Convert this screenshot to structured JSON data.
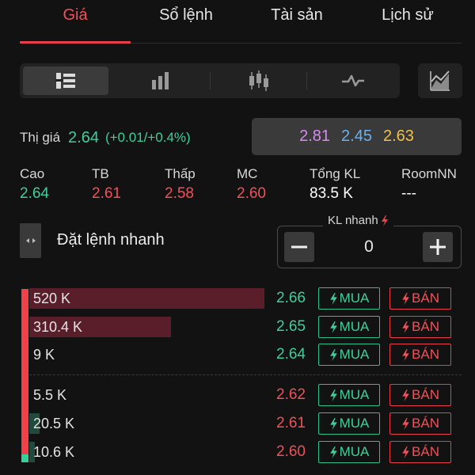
{
  "tabs": [
    {
      "label": "Giá",
      "active": true
    },
    {
      "label": "Sổ lệnh",
      "active": false
    },
    {
      "label": "Tài sản",
      "active": false
    },
    {
      "label": "Lịch sử",
      "active": false
    }
  ],
  "toolbar": {
    "icons": [
      "order-book-icon",
      "bar-chart-icon",
      "candlestick-icon",
      "line-chart-icon"
    ],
    "active_index": 0,
    "side_icon": "chart-expand-icon"
  },
  "price": {
    "label": "Thị giá",
    "value": "2.64",
    "change": "(+0.01/+0.4%)"
  },
  "reference": {
    "ceiling": "2.81",
    "floor": "2.45",
    "ref": "2.63"
  },
  "stats": [
    {
      "label": "Cao",
      "value": "2.64",
      "tone": "green"
    },
    {
      "label": "TB",
      "value": "2.61",
      "tone": "red"
    },
    {
      "label": "Thấp",
      "value": "2.58",
      "tone": "red"
    },
    {
      "label": "MC",
      "value": "2.60",
      "tone": "red"
    },
    {
      "label": "Tổng KL",
      "value": "83.5 K",
      "tone": "white"
    },
    {
      "label": "RoomNN",
      "value": "---",
      "tone": "white"
    }
  ],
  "quick_order": {
    "title": "Đặt lệnh nhanh",
    "kl_label": "KL nhanh",
    "quantity": "0",
    "minus": "−",
    "plus": "+"
  },
  "buy_label": "MUA",
  "sell_label": "BÁN",
  "sell_side": [
    {
      "volume": "520 K",
      "price": "2.66",
      "depth": 0.91
    },
    {
      "volume": "310.4 K",
      "price": "2.65",
      "depth": 0.55
    },
    {
      "volume": "9 K",
      "price": "2.64",
      "depth": 0.0
    }
  ],
  "buy_side": [
    {
      "volume": "5.5 K",
      "price": "2.62",
      "depth": 0.0
    },
    {
      "volume": "20.5 K",
      "price": "2.61",
      "depth": 0.04
    },
    {
      "volume": "10.6 K",
      "price": "2.60",
      "depth": 0.02
    }
  ],
  "colors": {
    "up": "#3ecf9c",
    "down": "#f0515a",
    "ceiling": "#d78bf0",
    "floor": "#6fb0ec",
    "reference": "#f0c04a",
    "active_tab": "#e8404a"
  }
}
